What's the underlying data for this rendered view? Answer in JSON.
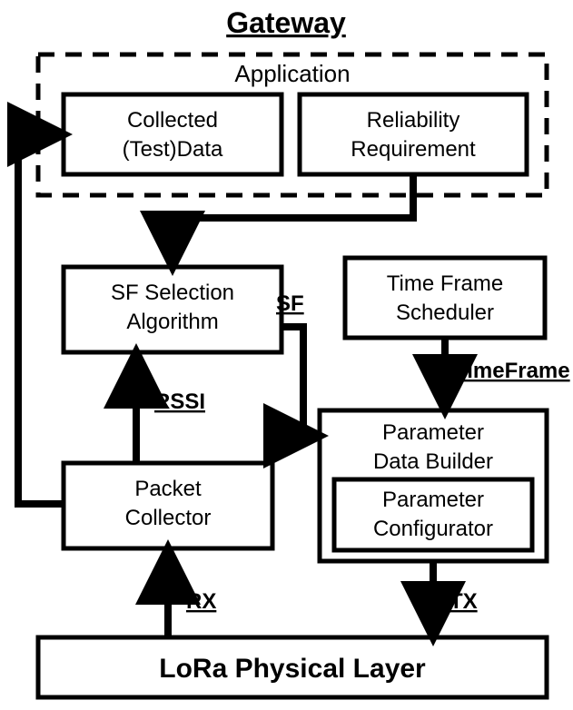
{
  "diagram": {
    "title": "Gateway",
    "application": {
      "label": "Application",
      "collectedData": {
        "line1": "Collected",
        "line2": "(Test)Data"
      },
      "reliability": {
        "line1": "Reliability",
        "line2": "Requirement"
      }
    },
    "sfSelection": {
      "line1": "SF Selection",
      "line2": "Algorithm"
    },
    "timeFrameScheduler": {
      "line1": "Time Frame",
      "line2": "Scheduler"
    },
    "parameterDataBuilder": {
      "line1": "Parameter",
      "line2": "Data Builder",
      "configurator": {
        "line1": "Parameter",
        "line2": "Configurator"
      }
    },
    "packetCollector": {
      "line1": "Packet",
      "line2": "Collector"
    },
    "phyLayer": "LoRa Physical Layer",
    "edges": {
      "sf": "SF",
      "timeFrame": "TimeFrame",
      "rssi": "RSSI",
      "rx": "RX",
      "tx": "TX"
    }
  }
}
